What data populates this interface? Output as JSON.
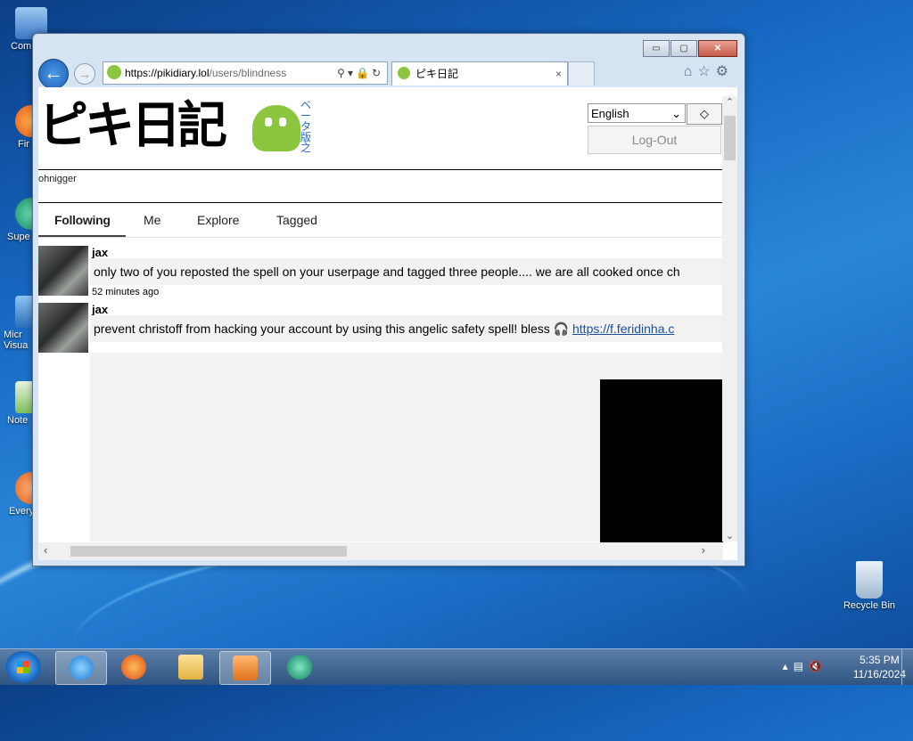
{
  "desktop": {
    "icons": [
      {
        "label": "Com"
      },
      {
        "label": "Fir"
      },
      {
        "label": "Supe"
      },
      {
        "label": "Micr Visua"
      },
      {
        "label": "Note"
      },
      {
        "label": "Every"
      },
      {
        "label": "Recycle Bin"
      }
    ]
  },
  "browser": {
    "address": {
      "host": "https://pikidiary.lol",
      "path": "/users/blindness"
    },
    "tab": {
      "title": "ピキ日記",
      "close": "×"
    },
    "controls": {
      "minimize": "▭",
      "maximize": "▢",
      "close": "✕"
    }
  },
  "site": {
    "logo_text": "ピキ日記",
    "beta_label": "ベータ版之",
    "language": {
      "selected": "English",
      "go": "◇"
    },
    "logout_label": "Log-Out",
    "username": "ohnigger",
    "tabs": [
      {
        "label": "Following",
        "active": true
      },
      {
        "label": "Me"
      },
      {
        "label": "Explore"
      },
      {
        "label": "Tagged"
      }
    ],
    "posts": [
      {
        "author": "jax",
        "text": "only two of you reposted the spell on your userpage and tagged three people.... we are all cooked once ch",
        "time": "52 minutes ago"
      },
      {
        "author": "jax",
        "text": "prevent christoff from hacking your account by using this angelic safety spell! bless 🎧 ",
        "link": "https://f.feridinha.c"
      }
    ]
  },
  "taskbar": {
    "time": "5:35 PM",
    "date": "11/16/2024"
  }
}
